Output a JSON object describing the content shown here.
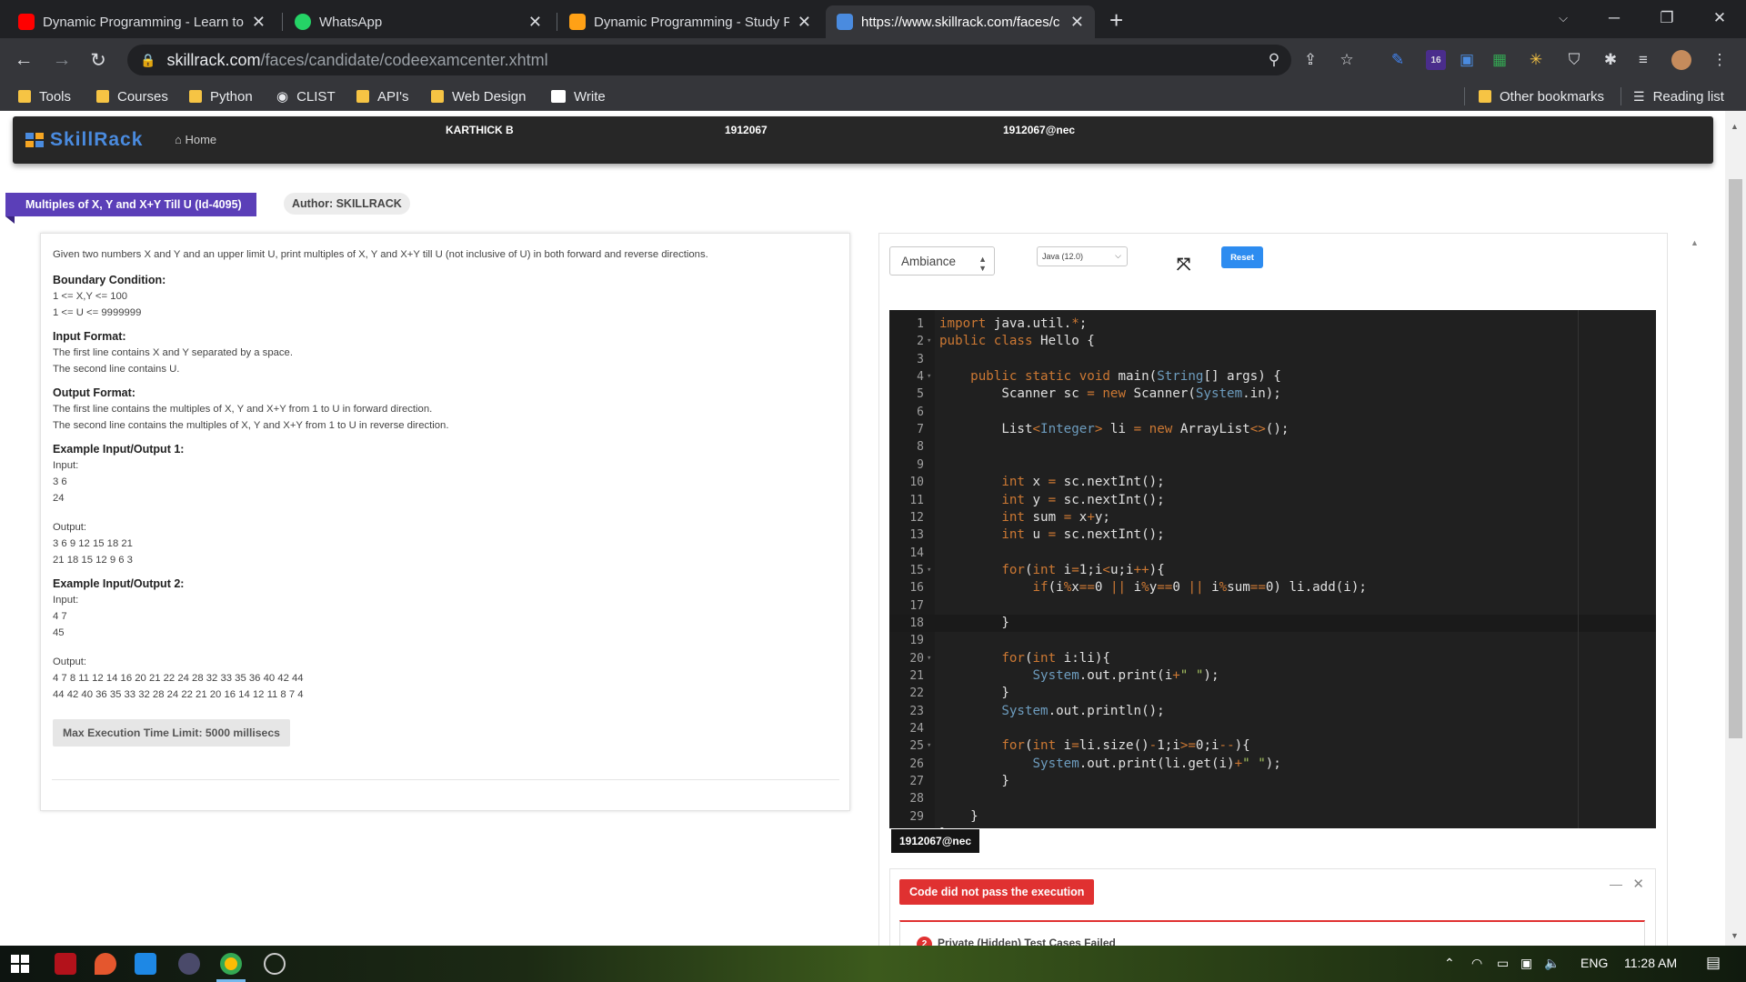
{
  "browser": {
    "tabs": [
      {
        "title": "Dynamic Programming - Learn to",
        "favicon": "youtube-icon",
        "color": "#ff0000"
      },
      {
        "title": "WhatsApp",
        "favicon": "whatsapp-icon",
        "color": "#25d366"
      },
      {
        "title": "Dynamic Programming - Study Pl",
        "favicon": "leetcode-icon",
        "color": "#ffa116"
      },
      {
        "title": "https://www.skillrack.com/faces/c",
        "favicon": "skillrack-icon",
        "color": "#4a8bdf"
      }
    ],
    "url_host": "skillrack.com",
    "url_path": "/faces/candidate/codeexamcenter.xhtml",
    "extension_badge": "16",
    "bookmarks": [
      "Tools",
      "Courses",
      "Python",
      "CLIST",
      "API's",
      "Web Design",
      "Write"
    ],
    "other_bookmarks": "Other bookmarks",
    "reading_list": "Reading list"
  },
  "skillrack": {
    "logo": "SkillRack",
    "home": "Home",
    "user_name": "KARTHICK B",
    "user_id": "1912067",
    "user_email": "1912067@nec"
  },
  "problem": {
    "title": "Multiples of X, Y and X+Y Till U (Id-4095)",
    "author": "Author: SKILLRACK",
    "statement": "Given two numbers X and Y and an upper limit U, print multiples of X, Y and X+Y till U (not inclusive of U) in both forward and reverse directions.",
    "boundary_heading": "Boundary Condition:",
    "boundary": [
      "1 <= X,Y <= 100",
      "1 <= U <= 9999999"
    ],
    "input_heading": "Input Format:",
    "input": [
      "The first line contains X and Y separated by a space.",
      "The second line contains U."
    ],
    "output_heading": "Output Format:",
    "output": [
      "The first line contains the multiples of X, Y and X+Y from 1 to U in forward direction.",
      "The second line contains the multiples of X, Y and X+Y from 1 to U in reverse direction."
    ],
    "example1_heading": "Example Input/Output 1:",
    "example1_input_label": "Input:",
    "example1_input": [
      "3 6",
      "24"
    ],
    "example1_output_label": "Output:",
    "example1_output": [
      "3 6 9 12 15 18 21",
      "21 18 15 12 9 6 3"
    ],
    "example2_heading": "Example Input/Output 2:",
    "example2_input_label": "Input:",
    "example2_input": [
      "4 7",
      "45"
    ],
    "example2_output_label": "Output:",
    "example2_output": [
      "4 7 8 11 12 14 16 20 21 22 24 28 32 33 35 36 40 42 44",
      "44 42 40 36 35 33 32 28 24 22 21 20 16 14 12 11 8 7 4"
    ],
    "max_time": "Max Execution Time Limit: 5000 millisecs"
  },
  "editor": {
    "theme": "Ambiance",
    "language": "Java (12.0)",
    "reset": "Reset",
    "active_line": 18,
    "folds": [
      2,
      4,
      15,
      20,
      25
    ],
    "code": [
      "import java.util.*;",
      "public class Hello {",
      "",
      "    public static void main(String[] args) {",
      "        Scanner sc = new Scanner(System.in);",
      "",
      "        List<Integer> li = new ArrayList<>();",
      "",
      "",
      "        int x = sc.nextInt();",
      "        int y = sc.nextInt();",
      "        int sum = x+y;",
      "        int u = sc.nextInt();",
      "",
      "        for(int i=1;i<u;i++){",
      "            if(i%x==0 || i%y==0 || i%sum==0) li.add(i);",
      "",
      "        }",
      "",
      "        for(int i:li){",
      "            System.out.print(i+\" \");",
      "        }",
      "        System.out.println();",
      "",
      "        for(int i=li.size()-1;i>=0;i--){",
      "            System.out.print(li.get(i)+\" \");",
      "        }",
      "",
      "    }",
      "}"
    ],
    "user_tag": "1912067@nec"
  },
  "result": {
    "status": "Code did not pass the execution",
    "count": "2",
    "detail": "Private (Hidden) Test Cases Failed"
  },
  "taskbar": {
    "language": "ENG",
    "time": "11:28 AM"
  }
}
